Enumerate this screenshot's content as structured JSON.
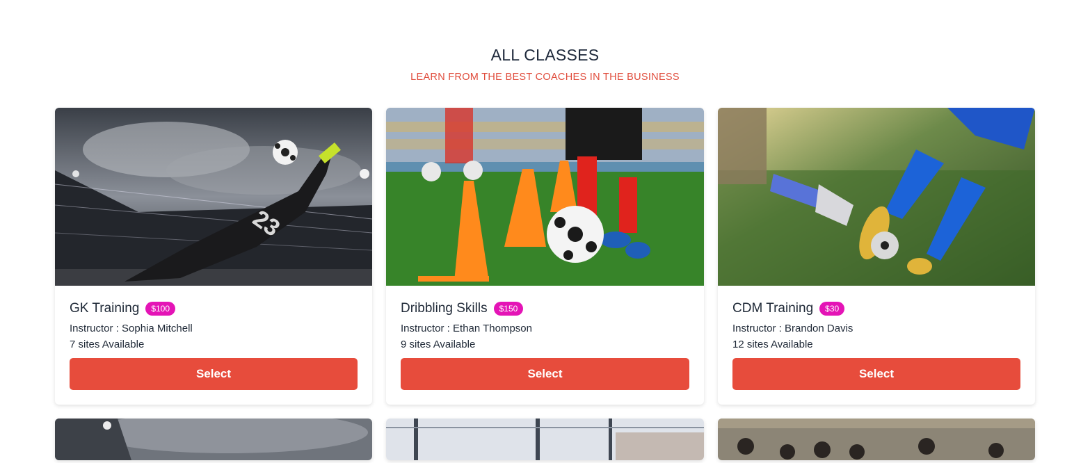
{
  "header": {
    "title": "ALL CLASSES",
    "subtitle": "LEARN FROM THE BEST COACHES IN THE BUSINESS"
  },
  "classes": [
    {
      "name": "GK Training",
      "price": "$100",
      "instructor": "Instructor : Sophia Mitchell",
      "sites": "7 sites Available",
      "button": "Select"
    },
    {
      "name": "Dribbling Skills",
      "price": "$150",
      "instructor": "Instructor : Ethan Thompson",
      "sites": "9 sites Available",
      "button": "Select"
    },
    {
      "name": "CDM Training",
      "price": "$30",
      "instructor": "Instructor : Brandon Davis",
      "sites": "12 sites Available",
      "button": "Select"
    }
  ],
  "colors": {
    "accent": "#e74c3c",
    "badge": "#e414b6",
    "subtitle": "#e04c3c"
  }
}
